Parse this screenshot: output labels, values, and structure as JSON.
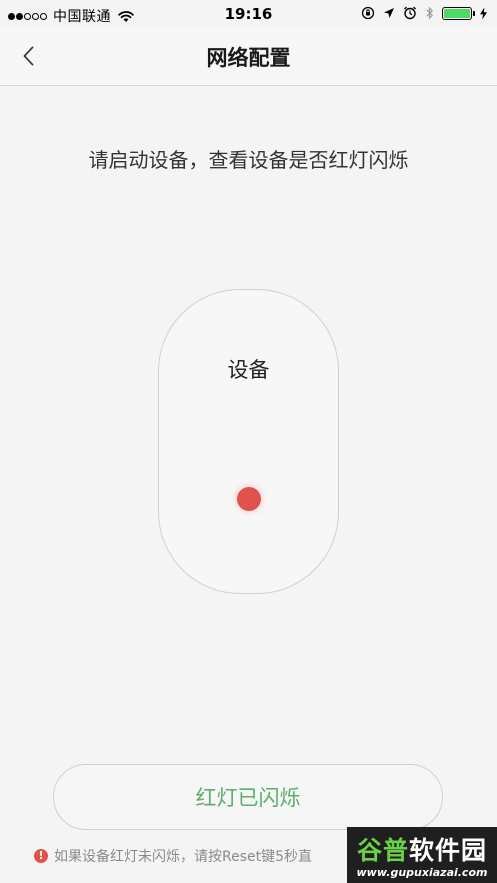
{
  "status_bar": {
    "signal_dots": [
      true,
      true,
      false,
      false,
      false
    ],
    "carrier": "中国联通",
    "time": "19:16",
    "battery_level": 1.0,
    "battery_color": "#4cd964",
    "icons": [
      "wifi-icon",
      "orientation-lock-icon",
      "location-icon",
      "alarm-icon",
      "bluetooth-icon",
      "battery-icon",
      "charging-icon"
    ]
  },
  "nav": {
    "title": "网络配置",
    "back_icon": "chevron-left-icon"
  },
  "main": {
    "instruction": "请启动设备，查看设备是否红灯闪烁",
    "device_label": "设备",
    "led_color": "#e0524a",
    "confirm_button": "红灯已闪烁",
    "confirm_color": "#5cae6a",
    "hint_icon_glyph": "!",
    "hint_text": "如果设备红灯未闪烁，请按Reset键5秒直"
  },
  "watermark": {
    "brand_part1": "谷普",
    "brand_part2": "软件园",
    "url": "www.gupuxiazai.com"
  }
}
